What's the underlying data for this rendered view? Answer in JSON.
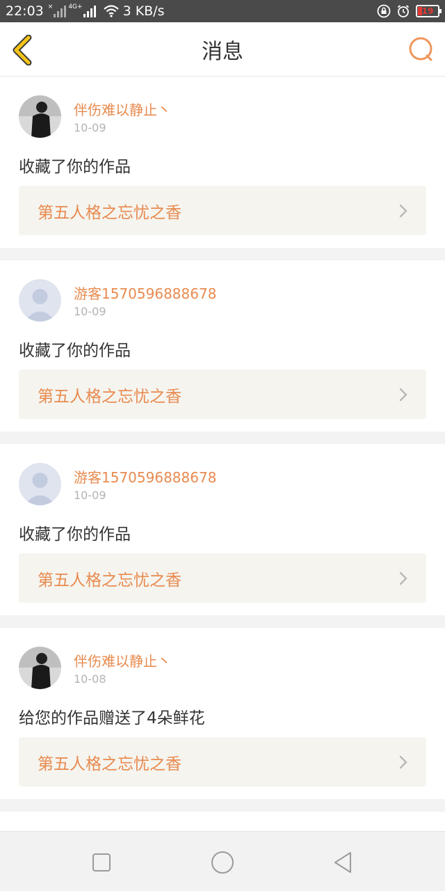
{
  "status_bar": {
    "time": "22:03",
    "network_small": "4G+",
    "speed": "3 KB/s",
    "battery": "19",
    "battery_color": "#e53935"
  },
  "header": {
    "title": "消息",
    "back_icon": "chevron-left-icon",
    "chat_icon": "chat-bubble-icon",
    "back_color": "#f5c518",
    "accent": "#e88a4e"
  },
  "messages": [
    {
      "user": "伴伤难以静止丶",
      "date": "10-09",
      "action": "收藏了你的作品",
      "work_title": "第五人格之忘忧之香",
      "avatar": "photo-avatar"
    },
    {
      "user": "游客1570596888678",
      "date": "10-09",
      "action": "收藏了你的作品",
      "work_title": "第五人格之忘忧之香",
      "avatar": "default-avatar"
    },
    {
      "user": "游客1570596888678",
      "date": "10-09",
      "action": "收藏了你的作品",
      "work_title": "第五人格之忘忧之香",
      "avatar": "default-avatar"
    },
    {
      "user": "伴伤难以静止丶",
      "date": "10-08",
      "action": "给您的作品赠送了4朵鲜花",
      "work_title": "第五人格之忘忧之香",
      "avatar": "photo-avatar"
    }
  ],
  "nav": {
    "recents_icon": "square-icon",
    "home_icon": "circle-icon",
    "back_icon": "triangle-back-icon"
  }
}
